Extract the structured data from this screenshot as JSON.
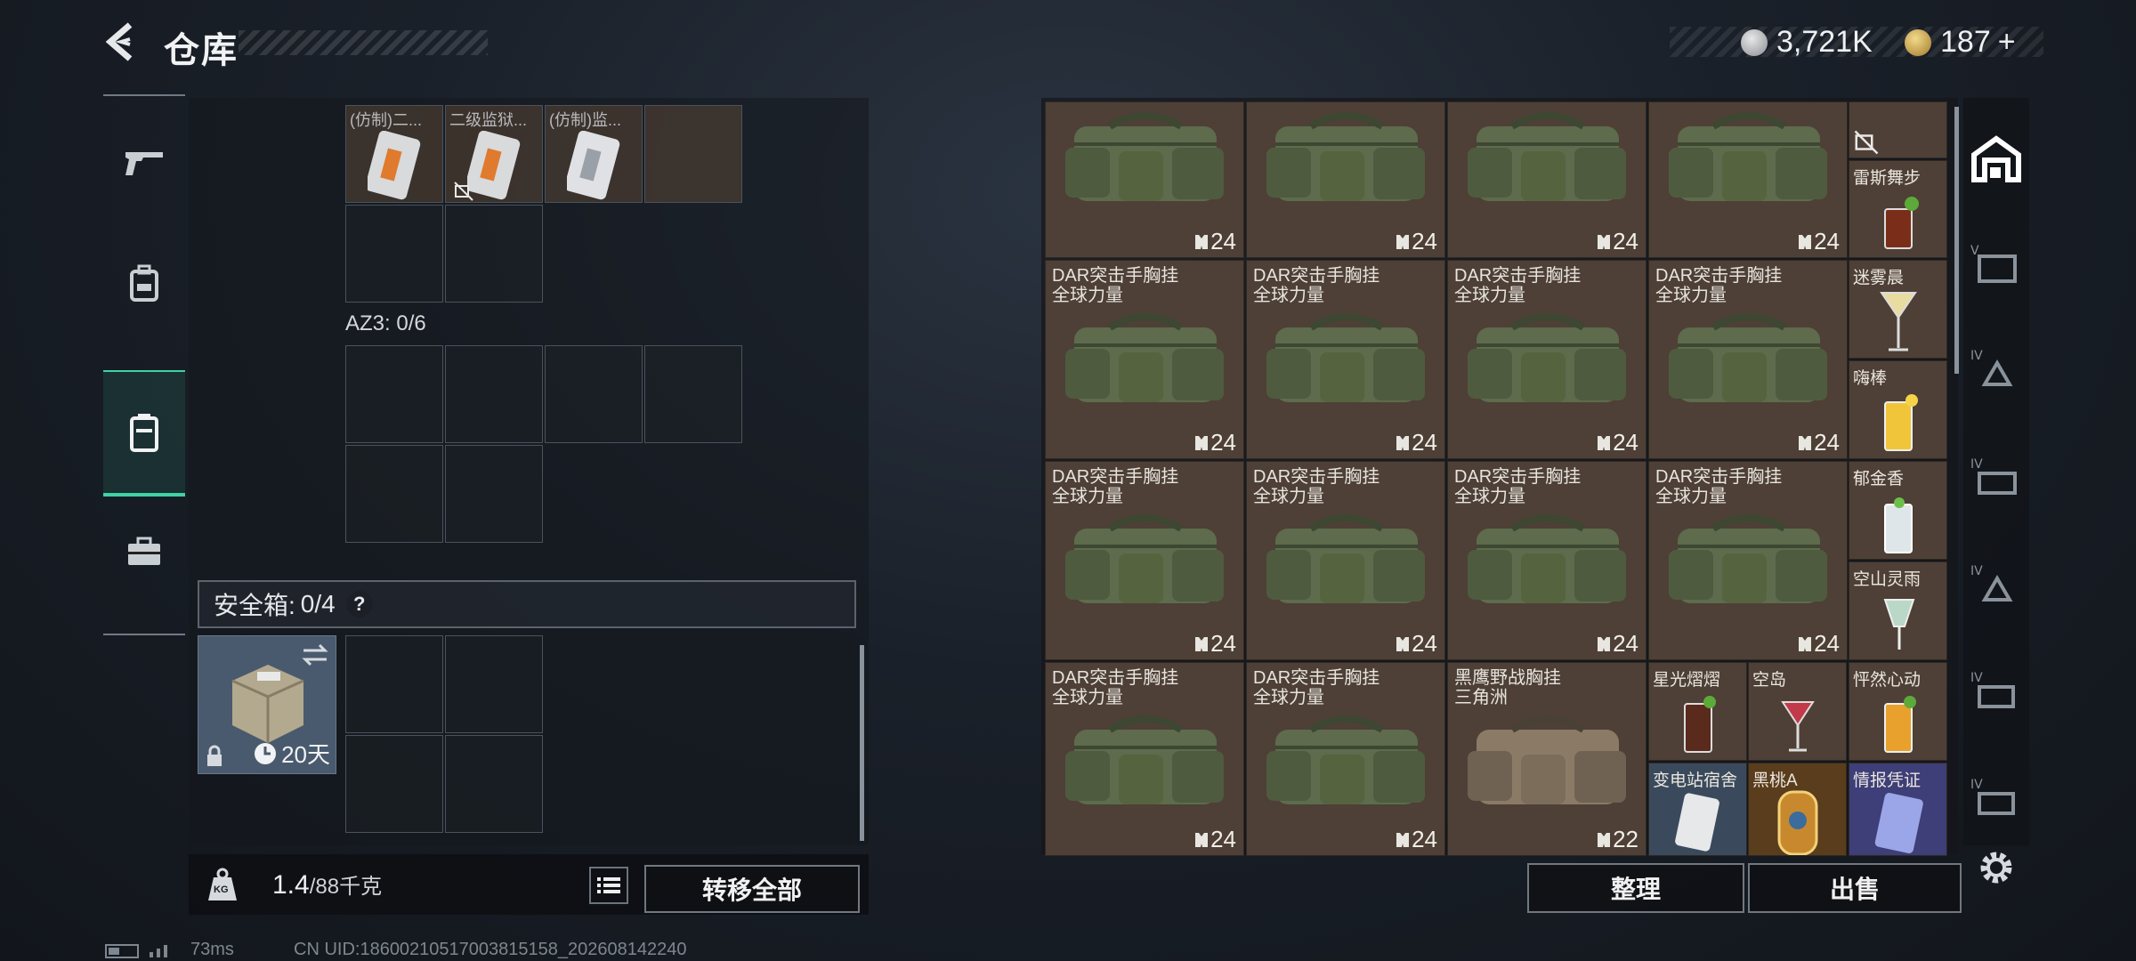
{
  "header": {
    "title": "仓库"
  },
  "currency": {
    "silver": "3,721K",
    "gold": "187",
    "plus": "+"
  },
  "nav": {
    "items": [
      "weapons",
      "backpack",
      "container",
      "toolbox"
    ],
    "active": 2
  },
  "left": {
    "top_items": [
      {
        "name": "(仿制)二..."
      },
      {
        "name": "二级监狱..."
      },
      {
        "name": "(仿制)监..."
      }
    ],
    "az3": "AZ3: 0/6",
    "safe_label": "安全箱:",
    "safe_count": "0/4",
    "help": "?",
    "safe_days": "20天",
    "weight": "1.4",
    "weight_max": "/88千克",
    "weight_icon_text": "KG",
    "transfer_all": "转移全部"
  },
  "grid": {
    "rows": [
      [
        {
          "name": "",
          "line2": "",
          "count": "24"
        },
        {
          "name": "",
          "line2": "",
          "count": "24"
        },
        {
          "name": "",
          "line2": "",
          "count": "24"
        },
        {
          "name": "",
          "line2": "",
          "count": "24"
        }
      ],
      [
        {
          "name": "DAR突击手胸挂",
          "line2": "全球力量",
          "count": "24"
        },
        {
          "name": "DAR突击手胸挂",
          "line2": "全球力量",
          "count": "24"
        },
        {
          "name": "DAR突击手胸挂",
          "line2": "全球力量",
          "count": "24"
        },
        {
          "name": "DAR突击手胸挂",
          "line2": "全球力量",
          "count": "24"
        }
      ],
      [
        {
          "name": "DAR突击手胸挂",
          "line2": "全球力量",
          "count": "24"
        },
        {
          "name": "DAR突击手胸挂",
          "line2": "全球力量",
          "count": "24"
        },
        {
          "name": "DAR突击手胸挂",
          "line2": "全球力量",
          "count": "24"
        },
        {
          "name": "DAR突击手胸挂",
          "line2": "全球力量",
          "count": "24"
        }
      ],
      [
        {
          "name": "DAR突击手胸挂",
          "line2": "全球力量",
          "count": "24"
        },
        {
          "name": "DAR突击手胸挂",
          "line2": "全球力量",
          "count": "24"
        },
        {
          "name": "黑鹰野战胸挂",
          "line2": "三角洲",
          "count": "22"
        }
      ]
    ],
    "drinks": [
      "雷斯舞步",
      "迷雾晨",
      "嗨棒",
      "郁金香",
      "空山灵雨"
    ],
    "small_row4": [
      "星光熠熠",
      "空岛",
      "怦然心动"
    ],
    "small_row5": [
      "变电站宿舍",
      "黑桃A",
      "情报凭证"
    ]
  },
  "actions": {
    "sort": "整理",
    "sell": "出售"
  },
  "status": {
    "ping": "73ms",
    "uid": "CN UID:18600210517003815158_202608142240"
  },
  "colors": {
    "accent": "#3fd2a5",
    "cell": "#4e4036",
    "bag": "#5e6b4c"
  }
}
